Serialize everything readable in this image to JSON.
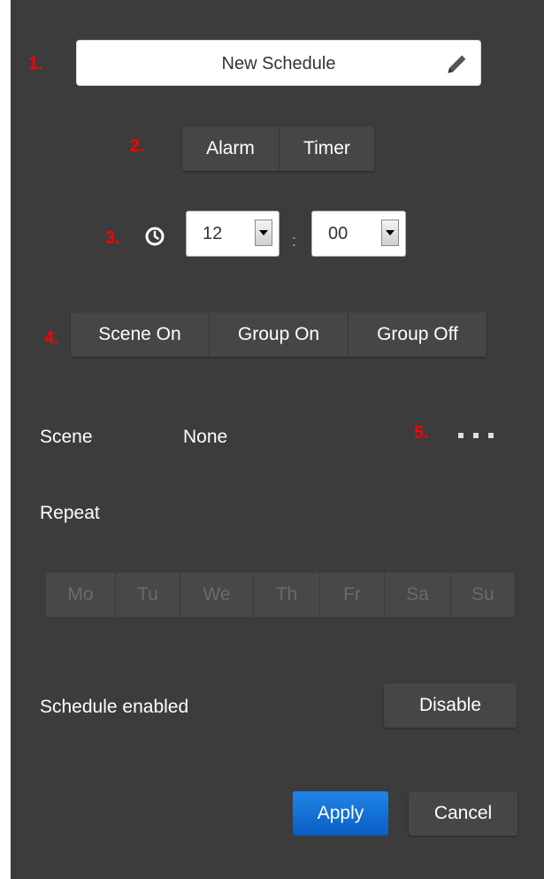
{
  "markers": {
    "m1": "1.",
    "m2": "2.",
    "m3": "3.",
    "m4": "4.",
    "m5": "5."
  },
  "schedule_name": {
    "value": "New Schedule",
    "edit_icon": "pencil-icon"
  },
  "mode_toggle": {
    "alarm": "Alarm",
    "timer": "Timer"
  },
  "time": {
    "clock_icon": "clock-icon",
    "hour": "12",
    "separator": ":",
    "minute": "00"
  },
  "action_tabs": {
    "scene_on": "Scene On",
    "group_on": "Group On",
    "group_off": "Group Off"
  },
  "scene": {
    "label": "Scene",
    "value": "None",
    "more_icon": "ellipsis-icon"
  },
  "repeat": {
    "label": "Repeat",
    "days": [
      "Mo",
      "Tu",
      "We",
      "Th",
      "Fr",
      "Sa",
      "Su"
    ]
  },
  "status": {
    "label": "Schedule enabled",
    "toggle_button": "Disable"
  },
  "footer": {
    "apply": "Apply",
    "cancel": "Cancel"
  },
  "colors": {
    "panel_bg": "#3c3c3c",
    "button_bg": "#464646",
    "accent": "#0a5dc4",
    "marker": "#ff0000"
  }
}
